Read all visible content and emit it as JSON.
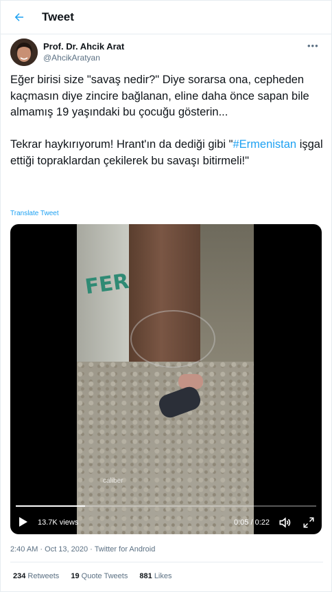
{
  "header": {
    "title": "Tweet"
  },
  "author": {
    "name": "Prof. Dr. Ahcik Arat",
    "handle": "@AhcikAratyan"
  },
  "tweet": {
    "text_part1": "Eğer birisi size \"savaş nedir?\" Diye sorarsa ona, cepheden kaçmasın diye zincire bağlanan, eline daha önce sapan bile almamış 19 yaşındaki bu çocuğu gösterin...\n\nTekrar haykırıyorum! Hrant'ın da dediği gibi \"",
    "hashtag": "#Ermenistan",
    "text_part2": " işgal ettiği topraklardan çekilerek bu savaşı bitirmeli!\"",
    "translate_label": "Translate Tweet"
  },
  "video": {
    "views": "13.7K views",
    "time": "0:05 / 0:22",
    "progress": 0.23,
    "painted_text": "FЕR",
    "watermark": "caliber"
  },
  "meta": "2:40 AM · Oct 13, 2020 · Twitter for Android",
  "stats": {
    "retweets_count": "234",
    "retweets_label": "Retweets",
    "quotes_count": "19",
    "quotes_label": "Quote Tweets",
    "likes_count": "881",
    "likes_label": "Likes"
  },
  "colors": {
    "accent": "#1da1f2"
  }
}
